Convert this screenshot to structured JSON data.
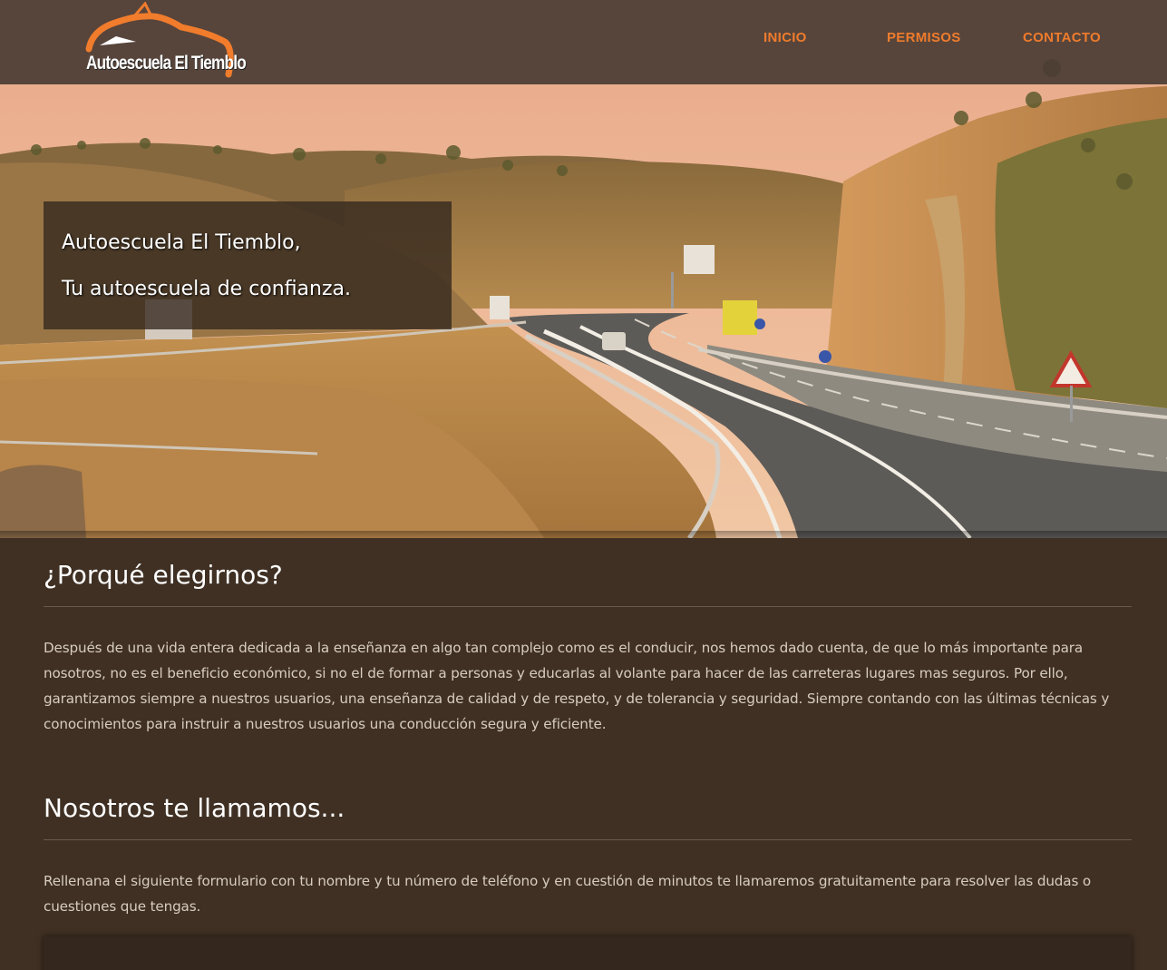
{
  "header": {
    "logo_text": "Autoescuela El Tiemblo",
    "nav": [
      {
        "label": "INICIO"
      },
      {
        "label": "PERMISOS"
      },
      {
        "label": "CONTACTO"
      }
    ]
  },
  "hero": {
    "line1": "Autoescuela El Tiemblo,",
    "line2": "Tu autoescuela de confianza."
  },
  "why": {
    "title": "¿Porqué elegirnos?",
    "text": "Después de una vida entera dedicada a la enseñanza en algo tan complejo como es el conducir, nos hemos dado cuenta, de que lo más importante para nosotros, no es el beneficio económico, si no el de formar a personas y educarlas al volante para hacer de las carreteras lugares mas seguros. Por ello, garantizamos siempre a nuestros usuarios, una enseñanza de calidad y de respeto, y de tolerancia y seguridad. Siempre contando con las últimas técnicas y conocimientos para instruir a nuestros usuarios una conducción segura y eficiente."
  },
  "call": {
    "title": "Nosotros te llamamos...",
    "text": "Rellenana el siguiente formulario con tu nombre y tu número de teléfono y en cuestión de minutos te llamaremos gratuitamente para resolver las dudas o cuestiones que tengas."
  },
  "colors": {
    "accent": "#f07c2c",
    "background": "#3f3023",
    "navbar": "#4a3c34"
  }
}
